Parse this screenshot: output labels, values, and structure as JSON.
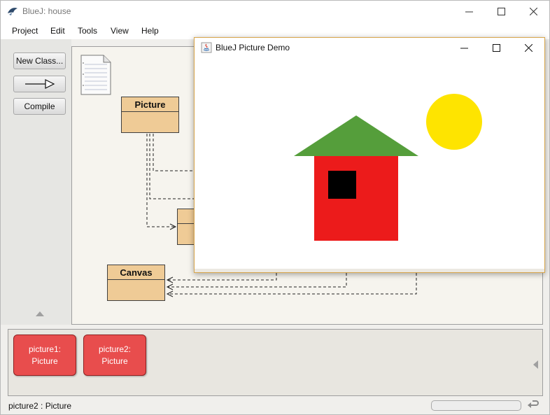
{
  "window": {
    "title": "BlueJ:  house",
    "minimize": "—",
    "maximize": "☐",
    "close": "✕"
  },
  "menu": [
    "Project",
    "Edit",
    "Tools",
    "View",
    "Help"
  ],
  "toolbar": {
    "new_class": "New Class...",
    "arrow": "——▷",
    "compile": "Compile"
  },
  "classes": [
    {
      "name": "Picture",
      "color": "#efcb96"
    },
    {
      "name": "Canvas",
      "color": "#efcb96"
    }
  ],
  "objects": [
    {
      "line1": "picture1:",
      "line2": "Picture",
      "color": "#e84d4d"
    },
    {
      "line1": "picture2:",
      "line2": "Picture",
      "color": "#e84d4d"
    }
  ],
  "status": "picture2 : Picture",
  "demo": {
    "title": "BlueJ Picture Demo",
    "minimize": "—",
    "maximize": "☐",
    "close": "✕",
    "colors": {
      "roof": "#559e3b",
      "wall": "#ec1b1b",
      "window": "#000000",
      "sun": "#fee400"
    }
  },
  "icons": [
    "bluej-icon",
    "readme-icon",
    "java-icon",
    "reset-icon"
  ]
}
